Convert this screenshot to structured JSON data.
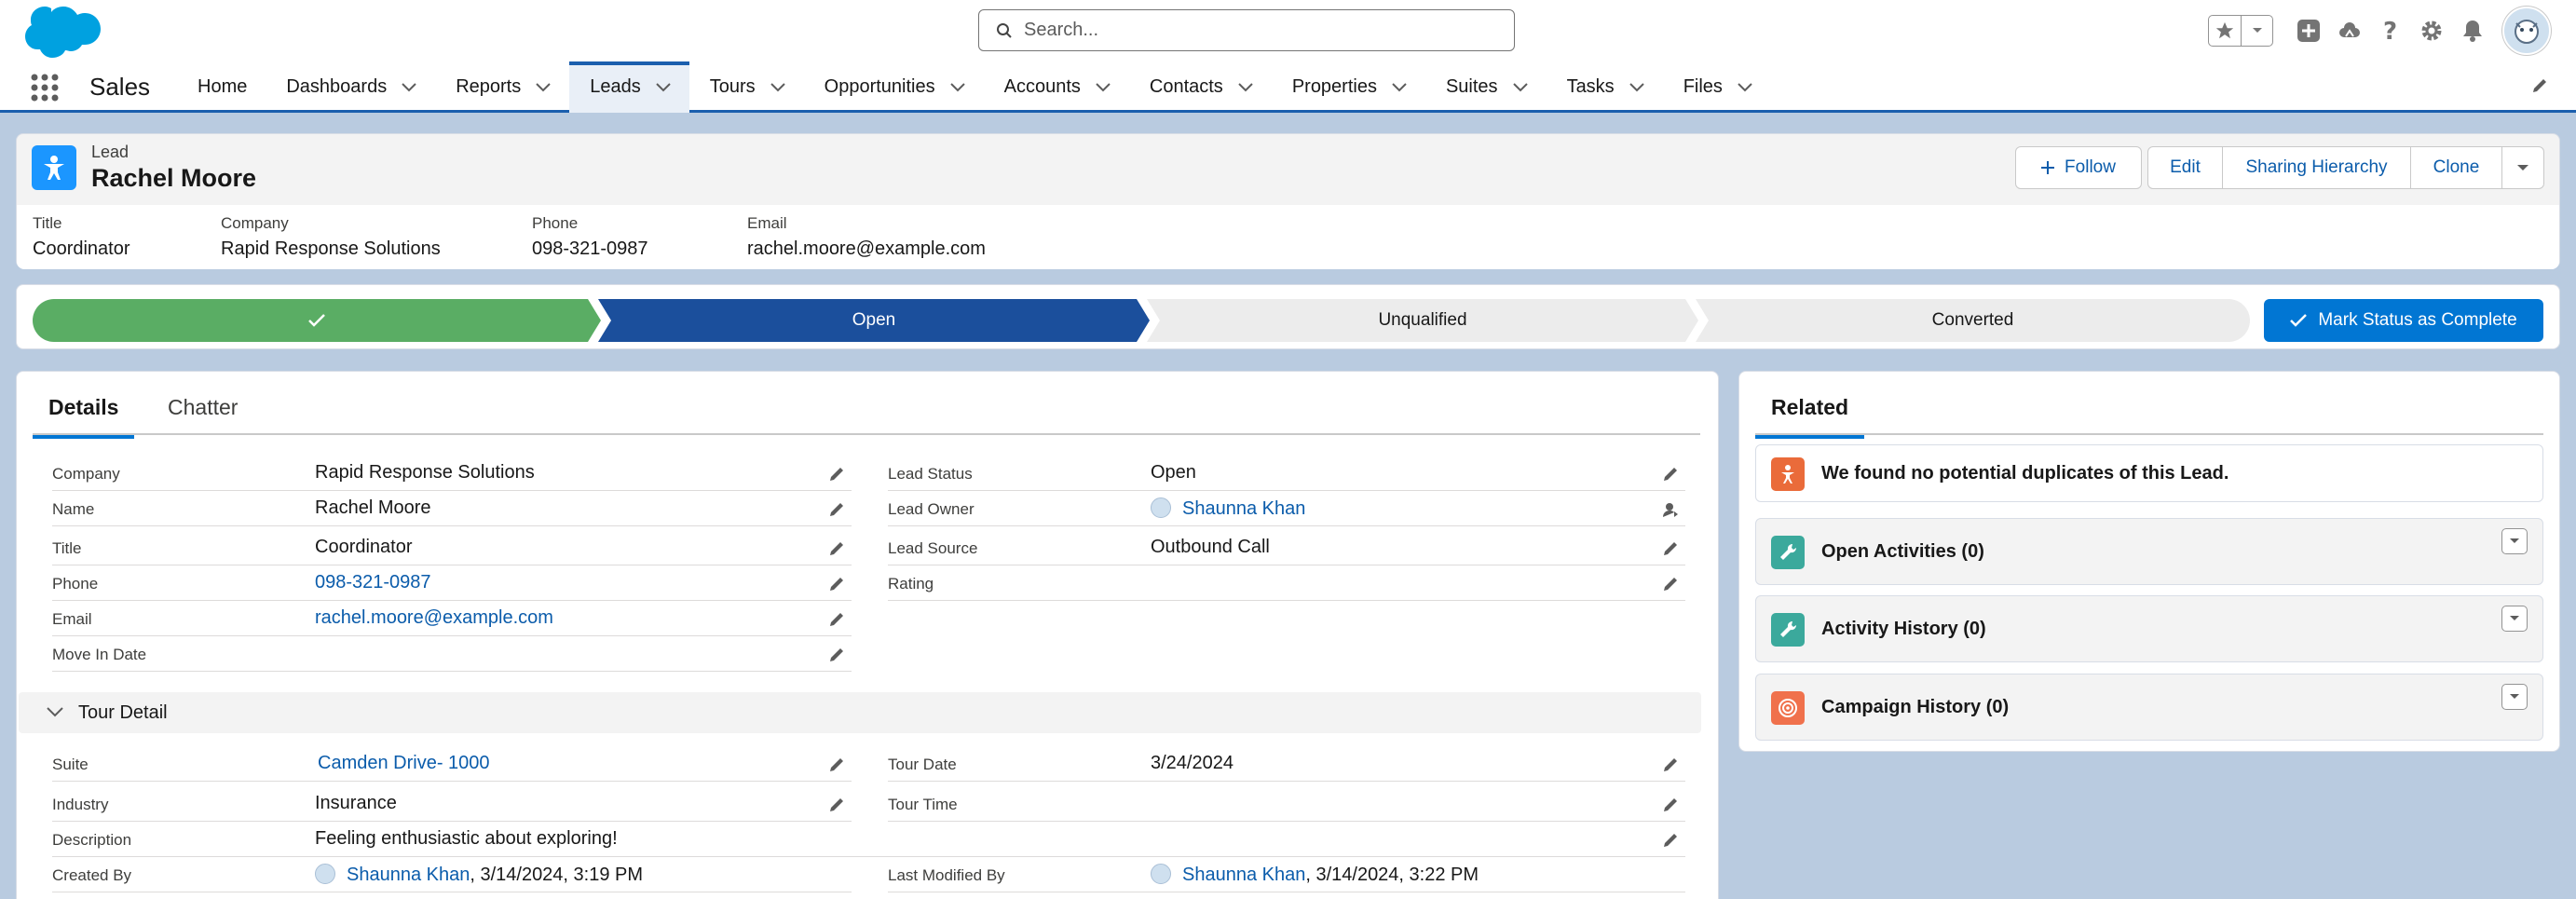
{
  "header": {
    "search_placeholder": "Search...",
    "icons": [
      "favorites-star-icon",
      "favorites-dropdown-icon",
      "global-add-icon",
      "trailhead-icon",
      "help-icon",
      "setup-gear-icon",
      "notifications-bell-icon",
      "user-avatar"
    ]
  },
  "nav": {
    "app_name": "Sales",
    "items": [
      {
        "label": "Home",
        "has_menu": false
      },
      {
        "label": "Dashboards",
        "has_menu": true
      },
      {
        "label": "Reports",
        "has_menu": true
      },
      {
        "label": "Leads",
        "has_menu": true,
        "active": true
      },
      {
        "label": "Tours",
        "has_menu": true
      },
      {
        "label": "Opportunities",
        "has_menu": true
      },
      {
        "label": "Accounts",
        "has_menu": true
      },
      {
        "label": "Contacts",
        "has_menu": true
      },
      {
        "label": "Properties",
        "has_menu": true
      },
      {
        "label": "Suites",
        "has_menu": true
      },
      {
        "label": "Tasks",
        "has_menu": true
      },
      {
        "label": "Files",
        "has_menu": true
      }
    ]
  },
  "record": {
    "entity": "Lead",
    "name": "Rachel Moore",
    "actions": {
      "follow": "Follow",
      "edit": "Edit",
      "sharing": "Sharing Hierarchy",
      "clone": "Clone"
    },
    "highlights": [
      {
        "label": "Title",
        "value": "Coordinator"
      },
      {
        "label": "Company",
        "value": "Rapid Response Solutions"
      },
      {
        "label": "Phone",
        "value": "098-321-0987"
      },
      {
        "label": "Email",
        "value": "rachel.moore@example.com"
      }
    ]
  },
  "path": {
    "stages": [
      "",
      "Open",
      "Unqualified",
      "Converted"
    ],
    "current": "Open",
    "mark_button": "Mark Status as Complete"
  },
  "details": {
    "tabs": [
      "Details",
      "Chatter"
    ],
    "left_fields": [
      {
        "label": "Company",
        "value": "Rapid Response Solutions"
      },
      {
        "label": "Name",
        "value": "Rachel Moore"
      },
      {
        "label": "Title",
        "value": "Coordinator"
      },
      {
        "label": "Phone",
        "value": "098-321-0987"
      },
      {
        "label": "Email",
        "value": "rachel.moore@example.com"
      },
      {
        "label": "Move In Date",
        "value": ""
      }
    ],
    "right_fields": [
      {
        "label": "Lead Status",
        "value": "Open"
      },
      {
        "label": "Lead Owner",
        "value": "Shaunna Khan"
      },
      {
        "label": "Lead Source",
        "value": "Outbound Call"
      },
      {
        "label": "Rating",
        "value": ""
      }
    ],
    "section_title": "Tour Detail",
    "tour_left": [
      {
        "label": "Suite",
        "value": "Camden Drive- 1000"
      },
      {
        "label": "Industry",
        "value": "Insurance"
      },
      {
        "label": "Description",
        "value": "Feeling enthusiastic about exploring!"
      },
      {
        "label": "Created By",
        "value": "Shaunna Khan",
        "extra": ", 3/14/2024, 3:19 PM"
      }
    ],
    "tour_right": [
      {
        "label": "Tour Date",
        "value": "3/24/2024"
      },
      {
        "label": "Tour Time",
        "value": ""
      },
      {
        "label": "Last Modified By",
        "value": "Shaunna Khan",
        "extra": ", 3/14/2024, 3:22 PM"
      }
    ]
  },
  "related": {
    "tab": "Related",
    "duplicates_message": "We found no potential duplicates of this Lead.",
    "lists": [
      {
        "title": "Open Activities (0)"
      },
      {
        "title": "Activity History (0)"
      },
      {
        "title": "Campaign History (0)"
      }
    ]
  },
  "colors": {
    "brand": "#0176d3",
    "path_complete": "#5aad64",
    "path_current": "#1b4f9c",
    "lead_icon": "#1b96ff",
    "duplicates_icon": "#ea6b3a",
    "activity_icon": "#3ba99c",
    "campaign_icon": "#f0714c"
  }
}
